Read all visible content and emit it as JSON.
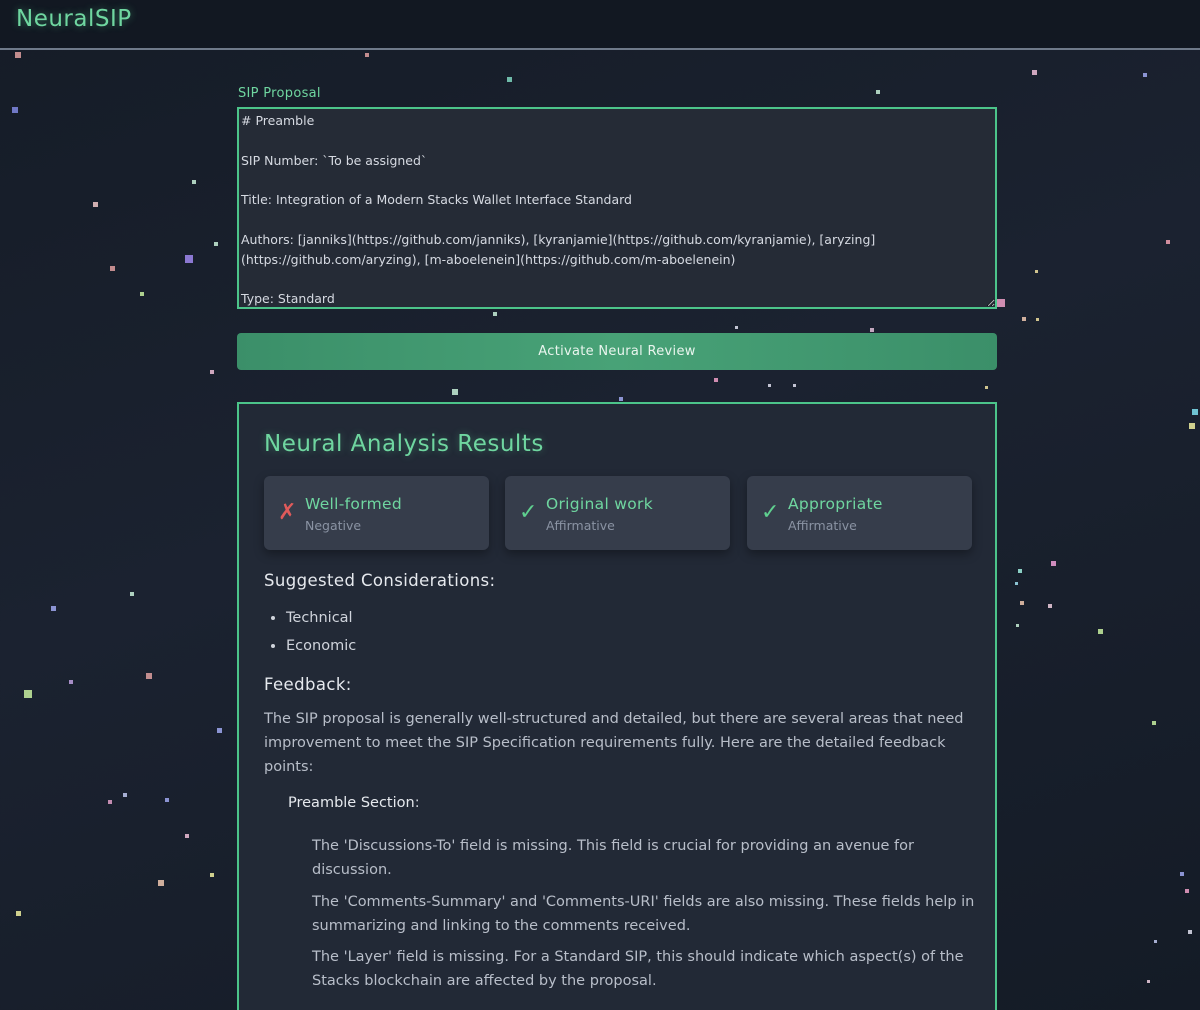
{
  "app": {
    "title": "NeuralSIP"
  },
  "proposal": {
    "label": "SIP Proposal",
    "text": "# Preamble\n\nSIP Number: `To be assigned`\n\nTitle: Integration of a Modern Stacks Wallet Interface Standard\n\nAuthors: [janniks](https://github.com/janniks), [kyranjamie](https://github.com/kyranjamie), [aryzing](https://github.com/aryzing), [m-aboelenein](https://github.com/m-aboelenein)\n\nType: Standard"
  },
  "review_button": {
    "label": "Activate Neural Review"
  },
  "results": {
    "title": "Neural Analysis Results",
    "verdicts": [
      {
        "label": "Well-formed",
        "value": "Negative",
        "icon": "cross-icon",
        "glyph": "✗",
        "color": "#e05a5a"
      },
      {
        "label": "Original work",
        "value": "Affirmative",
        "icon": "check-icon",
        "glyph": "✓",
        "color": "#5fd08f"
      },
      {
        "label": "Appropriate",
        "value": "Affirmative",
        "icon": "check-icon",
        "glyph": "✓",
        "color": "#5fd08f"
      }
    ],
    "considerations_heading": "Suggested Considerations:",
    "considerations": [
      "Technical",
      "Economic"
    ],
    "feedback_heading": "Feedback:",
    "feedback_intro": "The SIP proposal is generally well-structured and detailed, but there are several areas that need improvement to meet the SIP Specification requirements fully. Here are the detailed feedback points:",
    "preamble_section": {
      "title": "Preamble Section",
      "suffix": ":",
      "points": [
        "The 'Discussions-To' field is missing. This field is crucial for providing an avenue for discussion.",
        "The 'Comments-Summary' and 'Comments-URI' fields are also missing. These fields help in summarizing and linking to the comments received.",
        "The 'Layer' field is missing. For a Standard SIP, this should indicate which aspect(s) of the Stacks blockchain are affected by the proposal."
      ]
    }
  },
  "colors": {
    "accent": "#4cc48a",
    "accent_text": "#6fd6a0",
    "negative": "#e05a5a",
    "positive": "#5fd08f"
  }
}
